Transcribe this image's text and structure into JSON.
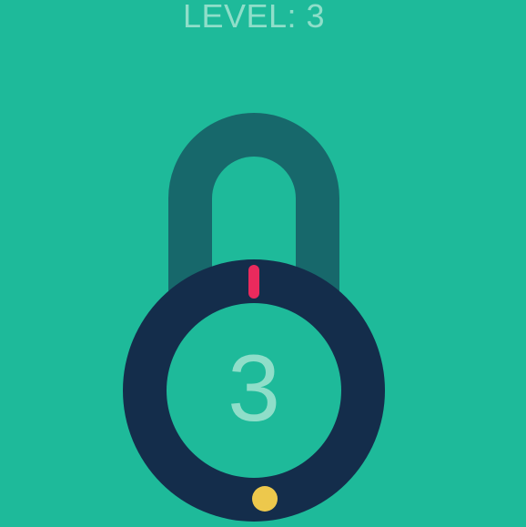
{
  "game": {
    "level_text": "LEVEL: 3",
    "remaining_count": "3"
  },
  "colors": {
    "background": "#1EBA9A",
    "shackle": "#17686B",
    "lock_ring": "#142D4B",
    "lock_center": "#1EBA9A",
    "text_muted": "#8FDEC9",
    "needle": "#EA2A5D",
    "target_dot": "#EDC84C"
  },
  "icons": {
    "shackle": "padlock-shackle-icon",
    "needle": "needle-icon",
    "target": "target-dot-icon"
  }
}
